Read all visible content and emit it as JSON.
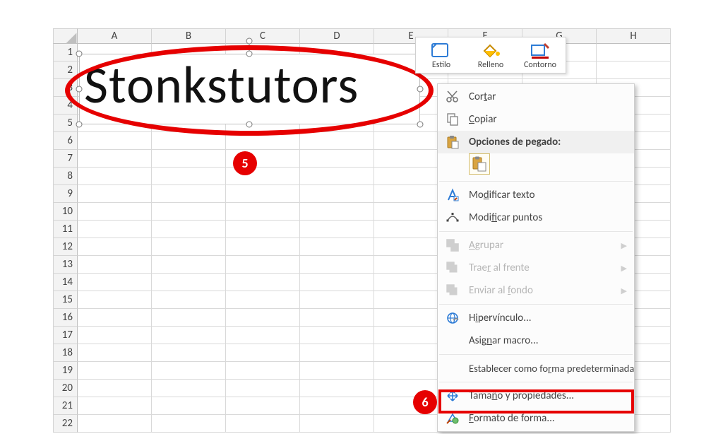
{
  "spreadsheet": {
    "columns": [
      "A",
      "B",
      "C",
      "D",
      "E",
      "F",
      "G",
      "H"
    ],
    "first_row": 1,
    "last_row": 22,
    "shape": {
      "text": "Stonkstutors"
    }
  },
  "mini_toolbar": {
    "style": "Estilo",
    "fill": "Relleno",
    "outline": "Contorno"
  },
  "context_menu": {
    "cut": "Cortar",
    "copy": "Copiar",
    "paste_header": "Opciones de pegado:",
    "edit_text": "Modificar texto",
    "edit_points": "Modificar puntos",
    "group": "Agrupar",
    "bring_front": "Traer al frente",
    "send_back": "Enviar al fondo",
    "hyperlink": "Hipervínculo...",
    "assign_macro": "Asignar macro...",
    "set_default": "Establecer como forma predeterminada",
    "size_props": "Tamaño y propiedades...",
    "format_shape": "Formato de forma..."
  },
  "annotations": {
    "dot5": "5",
    "dot6": "6"
  }
}
